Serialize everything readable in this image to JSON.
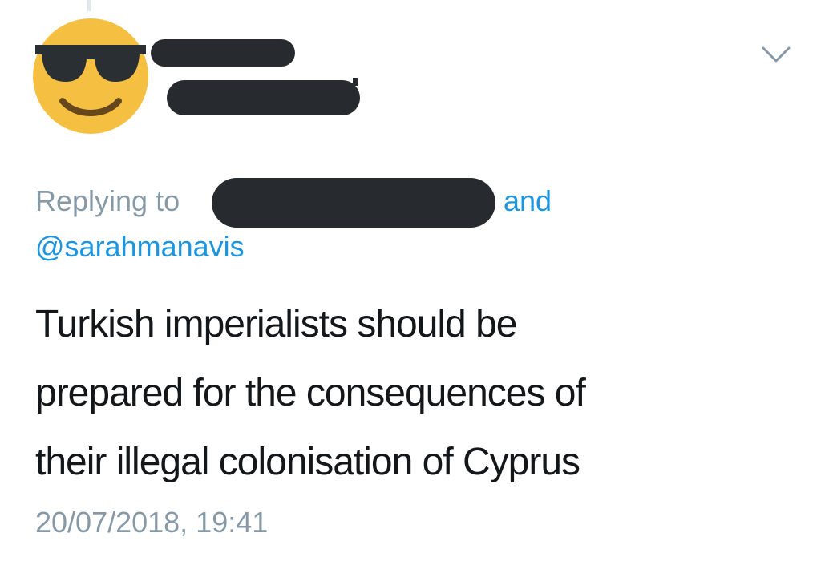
{
  "tweet": {
    "author": {
      "avatar_icon": "sunglasses-emoji-icon",
      "name_redacted": true,
      "handle_redacted": true
    },
    "menu_icon": "chevron-down-icon",
    "replying_to": {
      "label": "Replying to",
      "first_recipient_redacted": true,
      "conjunction": "and",
      "mention": "@sarahmanavis"
    },
    "text_lines": [
      "Turkish imperialists should be",
      "prepared for the consequences of",
      "their illegal colonisation of Cyprus"
    ],
    "timestamp": "20/07/2018, 19:41"
  },
  "colors": {
    "link": "#1b95e0",
    "secondary_text": "#8899a6",
    "primary_text": "#14171a",
    "redaction": "#272b30",
    "thread_line": "#e1e8ed"
  }
}
